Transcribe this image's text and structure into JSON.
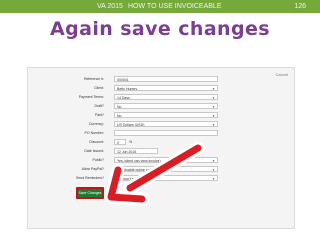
{
  "header": {
    "section_label": "VA 2015",
    "title": "HOW TO USE INVOICEABLE",
    "page_number": "126"
  },
  "headline": "Again save changes",
  "form": {
    "cancel_label": "Cancel",
    "fields": [
      {
        "label": "Reference #:",
        "value": "000001",
        "kind": "text"
      },
      {
        "label": "Client:",
        "value": "Betty Hungry",
        "kind": "select"
      },
      {
        "label": "Payment Terms:",
        "value": "14 Days",
        "kind": "select"
      },
      {
        "label": "Draft?",
        "value": "No",
        "kind": "select"
      },
      {
        "label": "Paid?",
        "value": "No",
        "kind": "select"
      },
      {
        "label": "Currency:",
        "value": "US Dollars (USD)",
        "kind": "select"
      },
      {
        "label": "PO Number:",
        "value": "",
        "kind": "text"
      },
      {
        "label": "Discount:",
        "value": "0",
        "kind": "percent",
        "unit": "%"
      },
      {
        "label": "Date Issued:",
        "value": "12 Jun 2015",
        "kind": "date"
      },
      {
        "label": "Public?",
        "value": "Yes (client can view invoice)",
        "kind": "select"
      },
      {
        "label": "Allow PayPal?",
        "value": "No, disable online payment",
        "kind": "select"
      },
      {
        "label": "Send Reminders?",
        "value": "No, don't send reminders",
        "kind": "select"
      }
    ],
    "save_label": "Save Changes"
  },
  "colors": {
    "topbar": "#75a93a",
    "headline": "#7a3f91",
    "save_button": "#1f7a34",
    "highlight": "#c0141b"
  }
}
